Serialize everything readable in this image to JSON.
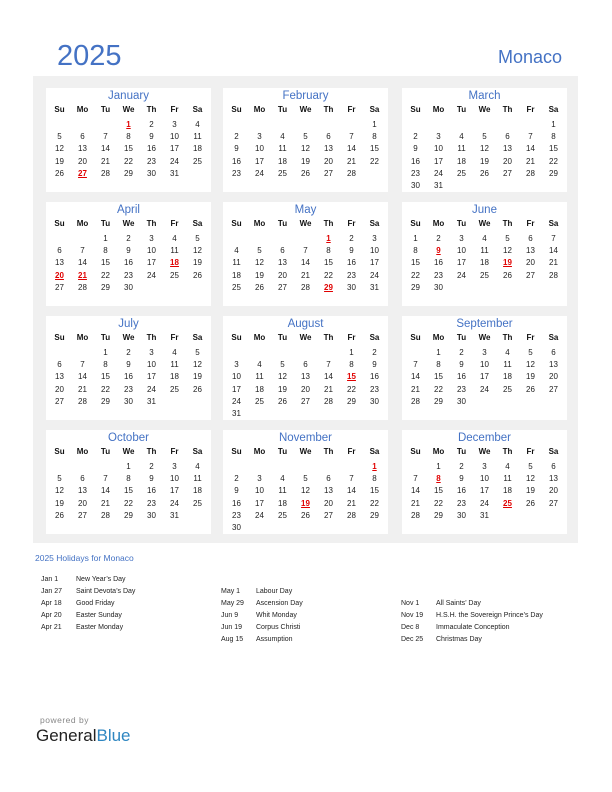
{
  "header": {
    "year": "2025",
    "country": "Monaco"
  },
  "dow": [
    "Su",
    "Mo",
    "Tu",
    "We",
    "Th",
    "Fr",
    "Sa"
  ],
  "colors": {
    "accent": "#4472c4",
    "holiday": "#e00000",
    "background_panel": "#f0f0f0"
  },
  "months": [
    {
      "name": "January",
      "start": 3,
      "days": 31,
      "holidays": [
        1,
        27
      ]
    },
    {
      "name": "February",
      "start": 6,
      "days": 28,
      "holidays": []
    },
    {
      "name": "March",
      "start": 6,
      "days": 31,
      "holidays": []
    },
    {
      "name": "April",
      "start": 2,
      "days": 30,
      "holidays": [
        18,
        20,
        21
      ]
    },
    {
      "name": "May",
      "start": 4,
      "days": 31,
      "holidays": [
        1,
        29
      ]
    },
    {
      "name": "June",
      "start": 0,
      "days": 30,
      "holidays": [
        9,
        19
      ]
    },
    {
      "name": "July",
      "start": 2,
      "days": 31,
      "holidays": []
    },
    {
      "name": "August",
      "start": 5,
      "days": 31,
      "holidays": [
        15
      ]
    },
    {
      "name": "September",
      "start": 1,
      "days": 30,
      "holidays": []
    },
    {
      "name": "October",
      "start": 3,
      "days": 31,
      "holidays": []
    },
    {
      "name": "November",
      "start": 6,
      "days": 30,
      "holidays": [
        1,
        19
      ]
    },
    {
      "name": "December",
      "start": 1,
      "days": 31,
      "holidays": [
        8,
        25
      ]
    }
  ],
  "holidays_section": {
    "title": "2025 Holidays for Monaco",
    "columns": [
      [
        {
          "date": "Jan 1",
          "name": "New Year’s Day"
        },
        {
          "date": "Jan 27",
          "name": "Saint Devota’s Day"
        },
        {
          "date": "Apr 18",
          "name": "Good Friday"
        },
        {
          "date": "Apr 20",
          "name": "Easter Sunday"
        },
        {
          "date": "Apr 21",
          "name": "Easter Monday"
        }
      ],
      [
        {
          "date": "May 1",
          "name": "Labour Day"
        },
        {
          "date": "May 29",
          "name": "Ascension Day"
        },
        {
          "date": "Jun 9",
          "name": "Whit Monday"
        },
        {
          "date": "Jun 19",
          "name": "Corpus Christi"
        },
        {
          "date": "Aug 15",
          "name": "Assumption"
        }
      ],
      [
        {
          "date": "Nov 1",
          "name": "All Saints’ Day"
        },
        {
          "date": "Nov 19",
          "name": "H.S.H. the Sovereign Prince’s Day"
        },
        {
          "date": "Dec 8",
          "name": "Immaculate Conception"
        },
        {
          "date": "Dec 25",
          "name": "Christmas Day"
        }
      ]
    ]
  },
  "footer": {
    "powered_by": "powered by",
    "brand_part1": "General",
    "brand_part2": "Blue"
  }
}
